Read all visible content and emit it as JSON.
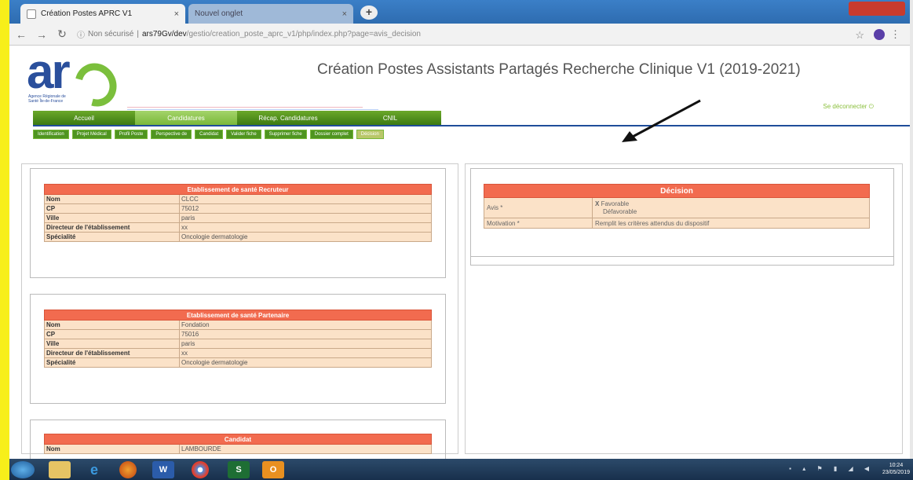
{
  "browser": {
    "active_tab_title": "Création Postes APRC V1",
    "inactive_tab_title": "Nouvel onglet",
    "tab_close": "×",
    "new_tab": "+",
    "secure_label": "Non sécurisé",
    "url_host": "ars79Gv/dev",
    "url_path": "/gestio/creation_poste_aprc_v1/php/index.php?page=avis_decision"
  },
  "header": {
    "page_title": "Création Postes Assistants Partagés Recherche Clinique V1 (2019-2021)",
    "logout_label": "Se déconnecter",
    "logo_subtitle": "Agence Régionale de Santé Île-de-France"
  },
  "main_nav": [
    "Accueil",
    "Candidatures",
    "Récap. Candidatures",
    "CNIL"
  ],
  "sub_nav": [
    "Identification",
    "Projet Médical",
    "Profil Poste",
    "Perspective de",
    "Candidat",
    "Valider fiche",
    "Supprimer fiche",
    "Dossier complet",
    "Décision"
  ],
  "recruteur": {
    "title": "Etablissement de santé Recruteur",
    "rows": [
      {
        "label": "Nom",
        "value": "CLCC"
      },
      {
        "label": "CP",
        "value": "75012"
      },
      {
        "label": "Ville",
        "value": "paris"
      },
      {
        "label": "Directeur de l'établissement",
        "value": "xx"
      },
      {
        "label": "Spécialité",
        "value": "Oncologie dermatologie"
      }
    ]
  },
  "partenaire": {
    "title": "Etablissement de santé Partenaire",
    "rows": [
      {
        "label": "Nom",
        "value": "Fondation"
      },
      {
        "label": "CP",
        "value": "75016"
      },
      {
        "label": "Ville",
        "value": "paris"
      },
      {
        "label": "Directeur de l'établissement",
        "value": "xx"
      },
      {
        "label": "Spécialité",
        "value": "Oncologie dermatologie"
      }
    ]
  },
  "candidat": {
    "title": "Candidat",
    "rows": [
      {
        "label": "Nom",
        "value": "LAMBOURDE"
      }
    ]
  },
  "decision": {
    "title": "Décision",
    "avis_label": "Avis *",
    "avis_selected_mark": "X",
    "avis_option_1": "Favorable",
    "avis_option_2": "Défavorable",
    "motivation_label": "Motivation *",
    "motivation_value": "Remplit les critères attendus du dispositif"
  },
  "taskbar": {
    "clock_time": "10:24",
    "clock_date": "23/05/2019"
  },
  "colors": {
    "header_red": "#f26b4f",
    "cell_beige": "#fbe2c8",
    "nav_green": "#4f9520",
    "brand_blue": "#2a4f9c"
  }
}
